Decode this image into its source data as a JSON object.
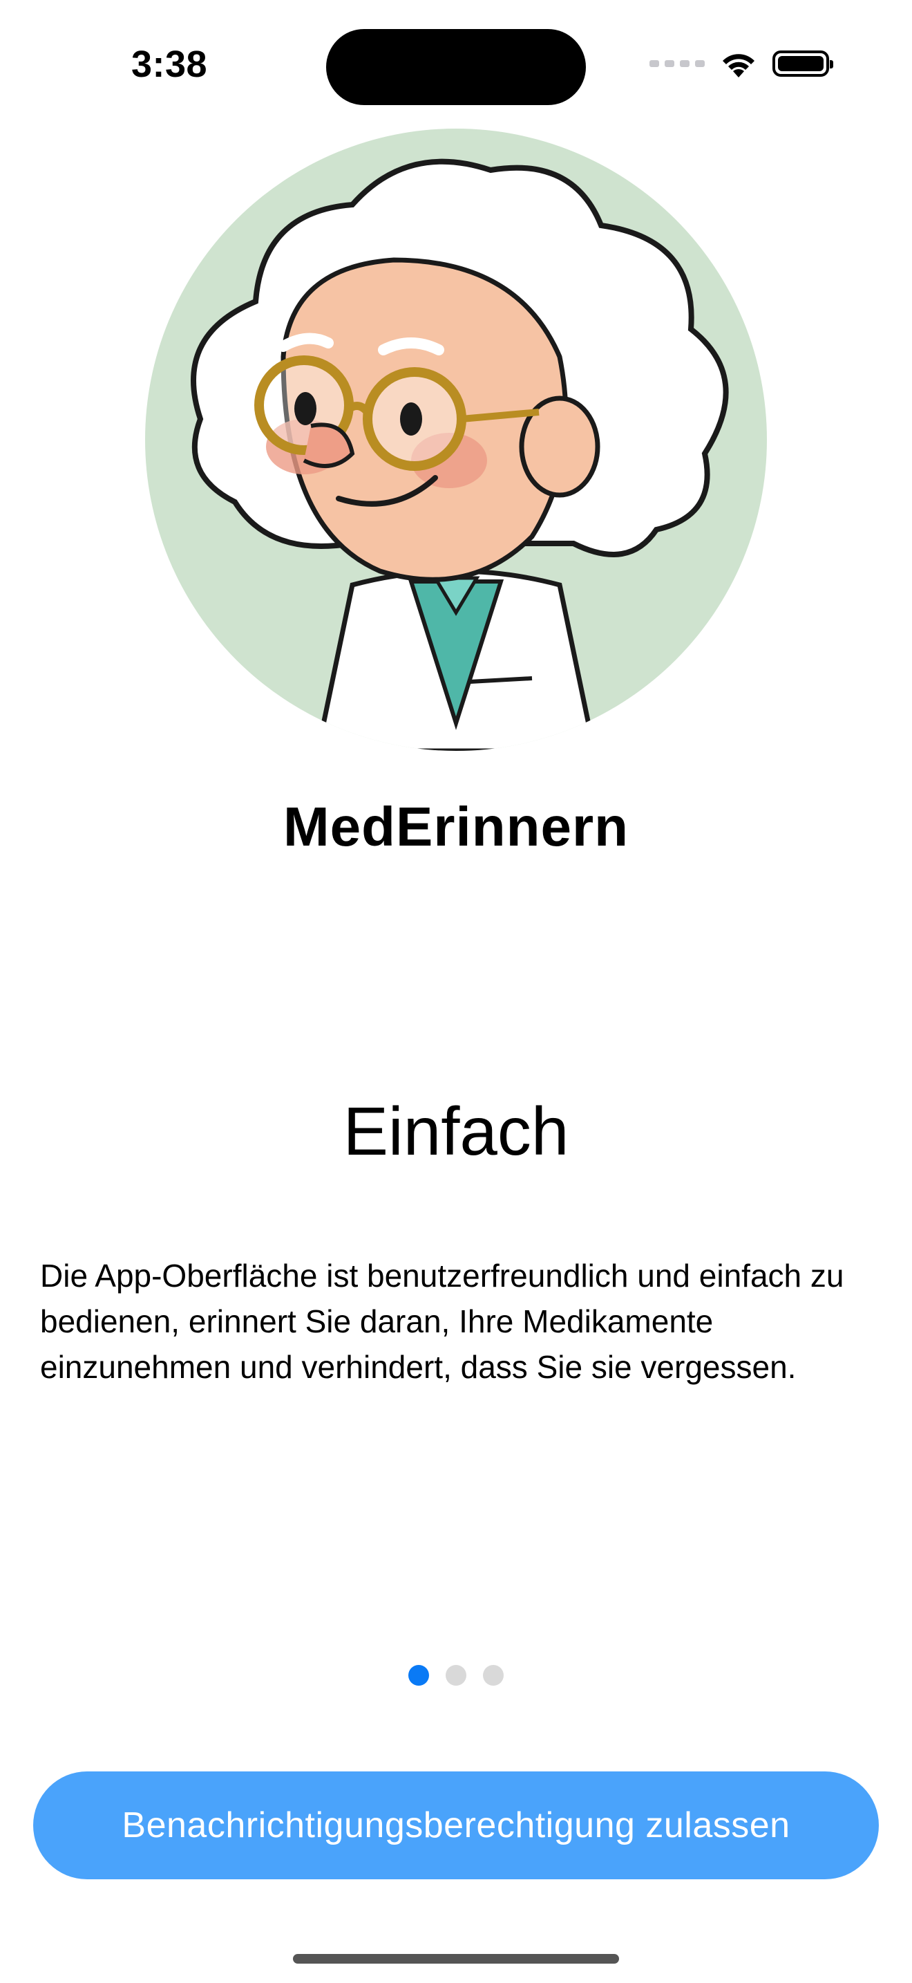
{
  "status_bar": {
    "time": "3:38"
  },
  "avatar": {
    "icon": "doctor-avatar-illustration",
    "background_color": "#cfe3cf"
  },
  "app": {
    "name": "MedErinnern"
  },
  "onboarding": {
    "title": "Einfach",
    "description": "Die App-Oberfläche ist benutzerfreundlich und einfach zu bedienen, erinnert Sie daran, Ihre Medikamente einzunehmen und verhindert, dass Sie sie vergessen.",
    "page_count": 3,
    "current_page": 1
  },
  "actions": {
    "allow_notifications_label": "Benachrichtigungsberechtigung zulassen"
  },
  "colors": {
    "accent": "#0a7af5",
    "button": "#4aa3fb",
    "dot_inactive": "#d9d9d9"
  }
}
